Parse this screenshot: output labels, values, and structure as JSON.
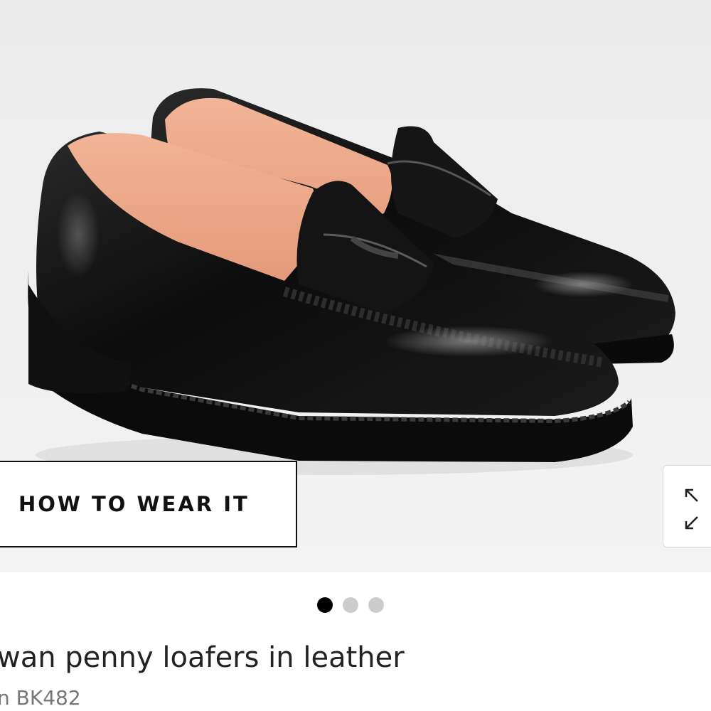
{
  "hero": {
    "image_alt": "black leather penny loafers",
    "how_to_wear_label": "HOW TO WEAR IT",
    "expand_icon": "expand-arrows-icon"
  },
  "carousel": {
    "dot_count": 3,
    "active_index": 0,
    "active_color": "#000000",
    "inactive_color": "#cccccc"
  },
  "product": {
    "title": "wan penny loafers in leather",
    "item_code": "n BK482"
  }
}
